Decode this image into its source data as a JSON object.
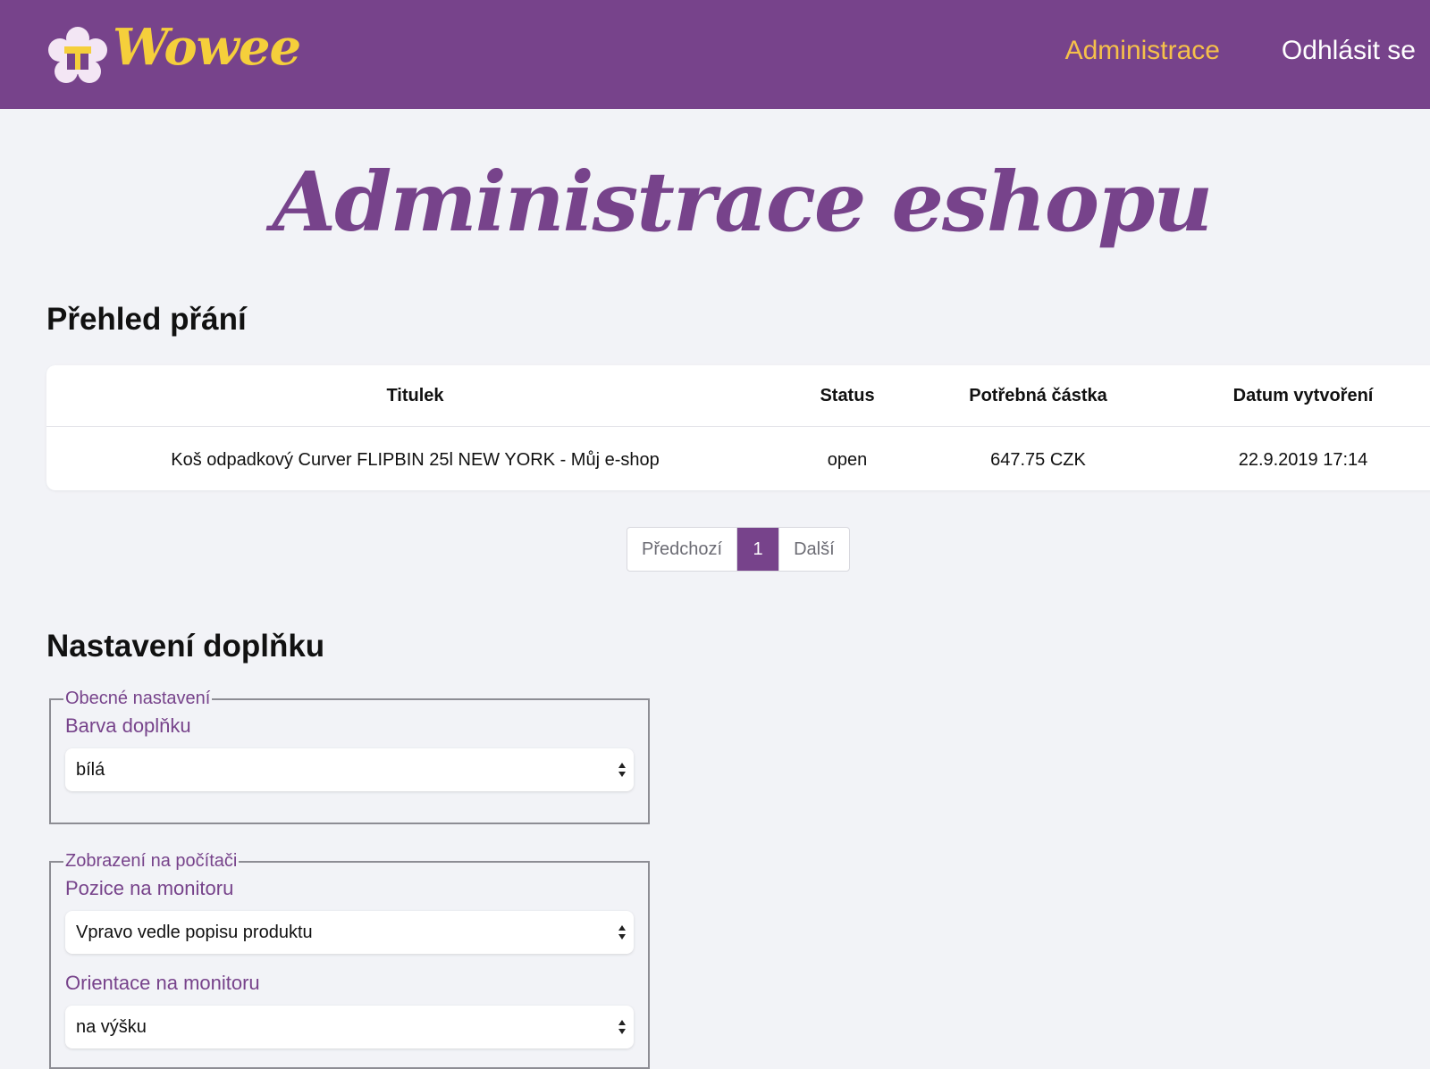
{
  "header": {
    "brand": "Wowee",
    "nav_admin": "Administrace",
    "nav_logout": "Odhlásit se",
    "colors": {
      "bar": "#77438b",
      "brand": "#f5cf3b",
      "active_link": "#f5c04a"
    }
  },
  "page": {
    "title": "Administrace eshopu"
  },
  "wishes": {
    "title": "Přehled přání",
    "columns": [
      "Titulek",
      "Status",
      "Potřebná částka",
      "Datum vytvoření"
    ],
    "rows": [
      [
        "Koš odpadkový Curver FLIPBIN 25l NEW YORK - Můj e-shop",
        "open",
        "647.75 CZK",
        "22.9.2019 17:14"
      ]
    ]
  },
  "pagination": {
    "prev": "Předchozí",
    "current": "1",
    "next": "Další"
  },
  "settings": {
    "title": "Nastavení doplňku",
    "general": {
      "legend": "Obecné nastavení",
      "color_label": "Barva doplňku",
      "color_value": "bílá"
    },
    "desktop": {
      "legend": "Zobrazení na počítači",
      "position_label": "Pozice na monitoru",
      "position_value": "Vpravo vedle popisu produktu",
      "orientation_label": "Orientace na monitoru",
      "orientation_value": "na výšku"
    }
  },
  "icons": {
    "logo": "gift-flower-logo-icon",
    "select": "select-arrows-icon"
  }
}
